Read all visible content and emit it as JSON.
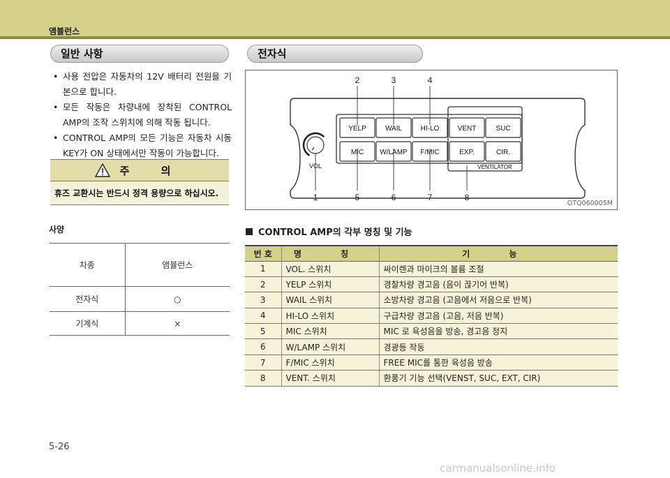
{
  "header": {
    "title": "앰뷸런스"
  },
  "general": {
    "title": "일반 사항",
    "bullets": [
      "사용 전압은 자동차의 12V 배터리 전원을 기본으로 합니다.",
      "모든 작동은 차량내에 장착된 CONTROL AMP의 조작 스위치에 의해 작동 됩니다.",
      "CONTROL AMP의 모든 기능은 자동차 시동 KEY가 ON 상태에서만 작동이 가능합니다."
    ]
  },
  "caution": {
    "title": "주 의",
    "text": "휴즈 교환시는 반드시 정격 용량으로 하십시오."
  },
  "spec": {
    "label": "사양",
    "rows": [
      [
        "차종",
        "앰뷸런스"
      ],
      [
        "전자식",
        "○"
      ],
      [
        "기계식",
        "×"
      ]
    ]
  },
  "electronic": {
    "title": "전자식",
    "figure_code": "OTQ060005M",
    "buttons_top": [
      "YELP",
      "WAIL",
      "HI-LO",
      "VENT",
      "SUC"
    ],
    "buttons_bottom": [
      "MIC",
      "W/LAMP",
      "F/MIC",
      "EXP.",
      "CIR."
    ],
    "ventilator_label": "VENTILATOR",
    "vol_label": "VOL",
    "callouts_top": [
      "2",
      "3",
      "4"
    ],
    "callouts_bottom": [
      "1",
      "5",
      "6",
      "7",
      "8"
    ]
  },
  "amp_section": {
    "title": "CONTROL AMP의 각부 명칭 및 기능",
    "headers": [
      "번 호",
      "명 칭",
      "기 능"
    ],
    "rows": [
      [
        "1",
        "VOL. 스위치",
        "싸이렌과 마이크의 볼륨 조절"
      ],
      [
        "2",
        "YELP 스위치",
        "경찰차량 경고음 (음이 끊기어 반복)"
      ],
      [
        "3",
        "WAIL 스위치",
        "소방차량 경고음 (고음에서 저음으로 반복)"
      ],
      [
        "4",
        "HI-LO 스위치",
        "구급차량 경고음 (고음, 저음 반복)"
      ],
      [
        "5",
        "MIC 스위치",
        "MIC 로 육성음을 방송, 경고음 정지"
      ],
      [
        "6",
        "W/LAMP 스위치",
        "경광등 작동"
      ],
      [
        "7",
        "F/MIC 스위치",
        "FREE MIC를 통한 육성음 방송"
      ],
      [
        "8",
        "VENT. 스위치",
        "환풍기 기능 선택(VENST, SUC, EXT, CIR)"
      ]
    ]
  },
  "page_number": "5-26",
  "watermark": "carmanualsonline.info"
}
